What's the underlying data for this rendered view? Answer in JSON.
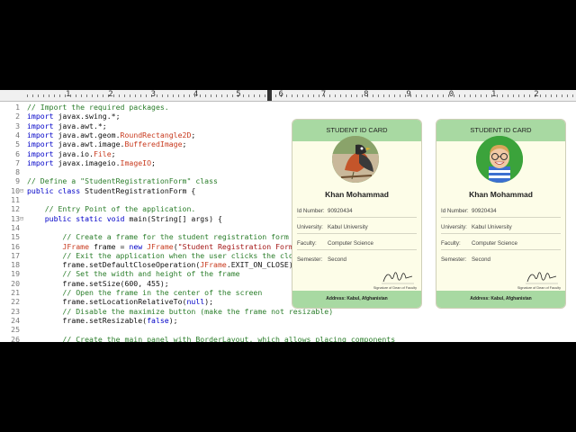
{
  "ruler": {
    "numbers": [
      "1",
      "2",
      "3",
      "4",
      "5",
      "6",
      "7",
      "8",
      "9",
      "0",
      "1",
      "2"
    ]
  },
  "code": [
    {
      "n": "1",
      "segs": [
        {
          "c": "cm",
          "t": "// Import the required packages."
        }
      ]
    },
    {
      "n": "2",
      "segs": [
        {
          "c": "kw",
          "t": "import"
        },
        {
          "c": "",
          "t": " javax.swing.*;"
        }
      ]
    },
    {
      "n": "3",
      "segs": [
        {
          "c": "kw",
          "t": "import"
        },
        {
          "c": "",
          "t": " java.awt.*;"
        }
      ]
    },
    {
      "n": "4",
      "segs": [
        {
          "c": "kw",
          "t": "import"
        },
        {
          "c": "",
          "t": " java.awt.geom."
        },
        {
          "c": "ty",
          "t": "RoundRectangle2D"
        },
        {
          "c": "",
          "t": ";"
        }
      ]
    },
    {
      "n": "5",
      "segs": [
        {
          "c": "kw",
          "t": "import"
        },
        {
          "c": "",
          "t": " java.awt.image."
        },
        {
          "c": "ty",
          "t": "BufferedImage"
        },
        {
          "c": "",
          "t": ";"
        }
      ]
    },
    {
      "n": "6",
      "segs": [
        {
          "c": "kw",
          "t": "import"
        },
        {
          "c": "",
          "t": " java.io."
        },
        {
          "c": "ty",
          "t": "File"
        },
        {
          "c": "",
          "t": ";"
        }
      ]
    },
    {
      "n": "7",
      "segs": [
        {
          "c": "kw",
          "t": "import"
        },
        {
          "c": "",
          "t": " javax.imageio."
        },
        {
          "c": "ty",
          "t": "ImageIO"
        },
        {
          "c": "",
          "t": ";"
        }
      ]
    },
    {
      "n": "8",
      "segs": []
    },
    {
      "n": "9",
      "segs": [
        {
          "c": "cm",
          "t": "// Define a \"StudentRegistrationForm\" class"
        }
      ]
    },
    {
      "n": "10",
      "fold": "⊟",
      "segs": [
        {
          "c": "kw",
          "t": "public class"
        },
        {
          "c": "",
          "t": " StudentRegistrationForm {"
        }
      ]
    },
    {
      "n": "11",
      "segs": []
    },
    {
      "n": "12",
      "segs": [
        {
          "c": "cm",
          "t": "    // Entry Point of the application."
        }
      ]
    },
    {
      "n": "13",
      "fold": "⊟",
      "segs": [
        {
          "c": "kw",
          "t": "    public static void"
        },
        {
          "c": "",
          "t": " main(String[] args) {"
        }
      ]
    },
    {
      "n": "14",
      "segs": []
    },
    {
      "n": "15",
      "segs": [
        {
          "c": "cm",
          "t": "        // Create a frame for the student registration form and"
        }
      ]
    },
    {
      "n": "16",
      "segs": [
        {
          "c": "ty",
          "t": "        JFrame"
        },
        {
          "c": "",
          "t": " frame = "
        },
        {
          "c": "kw",
          "t": "new"
        },
        {
          "c": "ty",
          "t": " JFrame"
        },
        {
          "c": "",
          "t": "("
        },
        {
          "c": "st",
          "t": "\"Student Registration Form\""
        },
        {
          "c": "",
          "t": ");"
        }
      ]
    },
    {
      "n": "17",
      "segs": [
        {
          "c": "cm",
          "t": "        // Exit the application when the user clicks the close"
        }
      ]
    },
    {
      "n": "18",
      "segs": [
        {
          "c": "",
          "t": "        frame.setDefaultCloseOperation("
        },
        {
          "c": "ty",
          "t": "JFrame"
        },
        {
          "c": "",
          "t": ".EXIT_ON_CLOSE);"
        }
      ]
    },
    {
      "n": "19",
      "segs": [
        {
          "c": "cm",
          "t": "        // Set the width and height of the frame"
        }
      ]
    },
    {
      "n": "20",
      "segs": [
        {
          "c": "",
          "t": "        frame.setSize(600, 455);"
        }
      ]
    },
    {
      "n": "21",
      "segs": [
        {
          "c": "cm",
          "t": "        // Open the frame in the center of the screen"
        }
      ]
    },
    {
      "n": "22",
      "segs": [
        {
          "c": "",
          "t": "        frame.setLocationRelativeTo("
        },
        {
          "c": "kw",
          "t": "null"
        },
        {
          "c": "",
          "t": ");"
        }
      ]
    },
    {
      "n": "23",
      "segs": [
        {
          "c": "cm",
          "t": "        // Disable the maximize button (make the frame not resizable)"
        }
      ]
    },
    {
      "n": "24",
      "segs": [
        {
          "c": "",
          "t": "        frame.setResizable("
        },
        {
          "c": "kw",
          "t": "false"
        },
        {
          "c": "",
          "t": ");"
        }
      ]
    },
    {
      "n": "25",
      "segs": []
    },
    {
      "n": "26",
      "segs": [
        {
          "c": "cm",
          "t": "        // Create the main panel with BorderLayout, which allows placing components"
        }
      ]
    }
  ],
  "cards": [
    {
      "title": "STUDENT ID CARD",
      "photo": "bird-photo",
      "name": "Khan Mohammad",
      "fields": [
        {
          "label": "Id Number:",
          "value": "90920434"
        },
        {
          "label": "University:",
          "value": "Kabul University"
        },
        {
          "label": "Faculty:",
          "value": "Computer Science"
        },
        {
          "label": "Semester:",
          "value": "Second"
        }
      ],
      "signature_label": "Signature of Dean of Faculty",
      "address": "Address: Kabul, Afghanistan"
    },
    {
      "title": "STUDENT ID CARD",
      "photo": "child-photo",
      "name": "Khan Mohammad",
      "fields": [
        {
          "label": "Id Number:",
          "value": "90920434"
        },
        {
          "label": "University:",
          "value": "Kabul University"
        },
        {
          "label": "Faculty:",
          "value": "Computer Science"
        },
        {
          "label": "Semester:",
          "value": "Second"
        }
      ],
      "signature_label": "Signature of Dean of Faculty",
      "address": "Address: Kabul, Afghanistan"
    }
  ],
  "colors": {
    "header_green": "#a8d9a2",
    "card_bg": "#fdfde8",
    "comment": "#2a7d2a",
    "keyword": "#0000c8",
    "string": "#a31515",
    "type": "#c83a1e"
  }
}
